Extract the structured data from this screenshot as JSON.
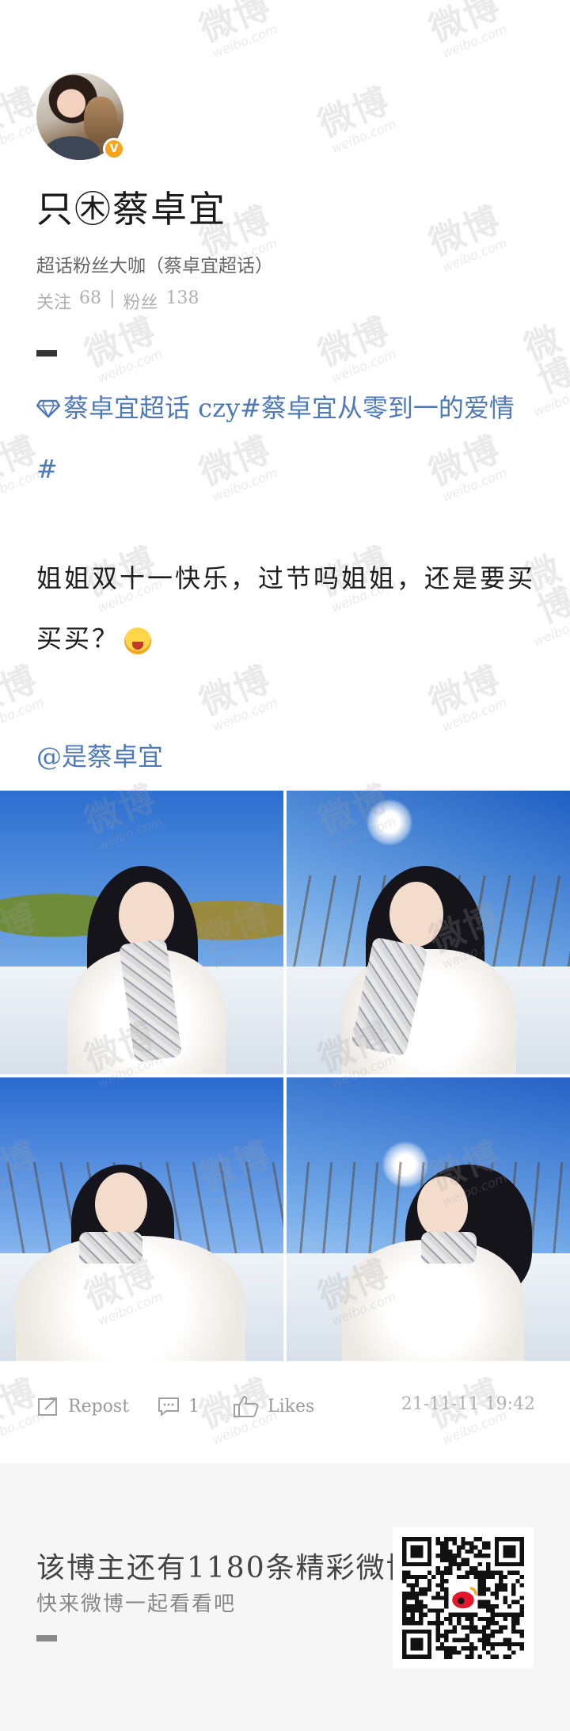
{
  "user": {
    "name": "只㊍蔡卓宜",
    "verified_badge": "V",
    "description": "超话粉丝大咖（蔡卓宜超话）",
    "following_label": "关注",
    "following_count": "68",
    "separator": "|",
    "followers_label": "粉丝",
    "followers_count": "138"
  },
  "post": {
    "topic_text": "蔡卓宜超话 czy#蔡卓宜从零到一的爱情#",
    "body_text": "姐姐双十一快乐，过节吗姐姐，还是要买买买？",
    "mention": "@是蔡卓宜",
    "photos": [
      {
        "alt": "photo-1"
      },
      {
        "alt": "photo-2"
      },
      {
        "alt": "photo-3"
      },
      {
        "alt": "photo-4"
      }
    ]
  },
  "actions": {
    "repost_label": "Repost",
    "comment_count": "1",
    "like_label": "Likes",
    "timestamp": "21-11-11 19:42"
  },
  "footer": {
    "title": "该博主还有1180条精彩微博",
    "subtitle": "快来微博一起看看吧"
  },
  "watermark": {
    "zh": "微博",
    "en": "weibo.com"
  },
  "colors": {
    "link": "#4f7ab8",
    "badge": "#f7a51c",
    "muted": "#9a9a9a"
  }
}
